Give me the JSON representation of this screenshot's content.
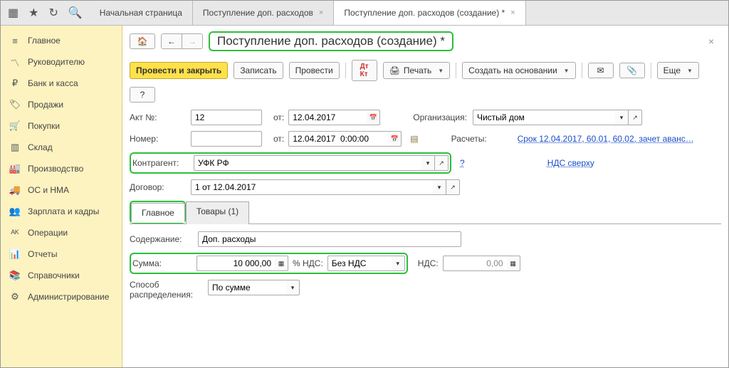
{
  "tabs": {
    "t0": "Начальная страница",
    "t1": "Поступление доп. расходов",
    "t2": "Поступление доп. расходов (создание) *"
  },
  "sidebar": {
    "items": [
      {
        "label": "Главное"
      },
      {
        "label": "Руководителю"
      },
      {
        "label": "Банк и касса"
      },
      {
        "label": "Продажи"
      },
      {
        "label": "Покупки"
      },
      {
        "label": "Склад"
      },
      {
        "label": "Производство"
      },
      {
        "label": "ОС и НМА"
      },
      {
        "label": "Зарплата и кадры"
      },
      {
        "label": "Операции"
      },
      {
        "label": "Отчеты"
      },
      {
        "label": "Справочники"
      },
      {
        "label": "Администрирование"
      }
    ]
  },
  "page": {
    "title": "Поступление доп. расходов (создание) *"
  },
  "toolbar": {
    "post_close": "Провести и закрыть",
    "save": "Записать",
    "post": "Провести",
    "print": "Печать",
    "create_based": "Создать на основании",
    "more": "Еще"
  },
  "form": {
    "act_no_label": "Акт №:",
    "act_no": "12",
    "from_label": "от:",
    "act_date": "12.04.2017",
    "number_label": "Номер:",
    "number": "",
    "number_date": "12.04.2017  0:00:00",
    "org_label": "Организация:",
    "org": "Чистый дом",
    "calc_label": "Расчеты:",
    "calc_link": "Срок 12.04.2017, 60.01, 60.02, зачет аванс…",
    "counterparty_label": "Контрагент:",
    "counterparty": "УФК РФ",
    "vat_link": "НДС сверху",
    "contract_label": "Договор:",
    "contract": "1 от 12.04.2017"
  },
  "dtabs": {
    "main": "Главное",
    "goods": "Товары (1)"
  },
  "main_tab": {
    "content_label": "Содержание:",
    "content": "Доп. расходы",
    "sum_label": "Сумма:",
    "sum": "10 000,00",
    "vat_pct_label": "% НДС:",
    "vat_pct": "Без НДС",
    "vat_label": "НДС:",
    "vat": "0,00",
    "distrib_label1": "Способ",
    "distrib_label2": "распределения:",
    "distrib": "По сумме"
  }
}
